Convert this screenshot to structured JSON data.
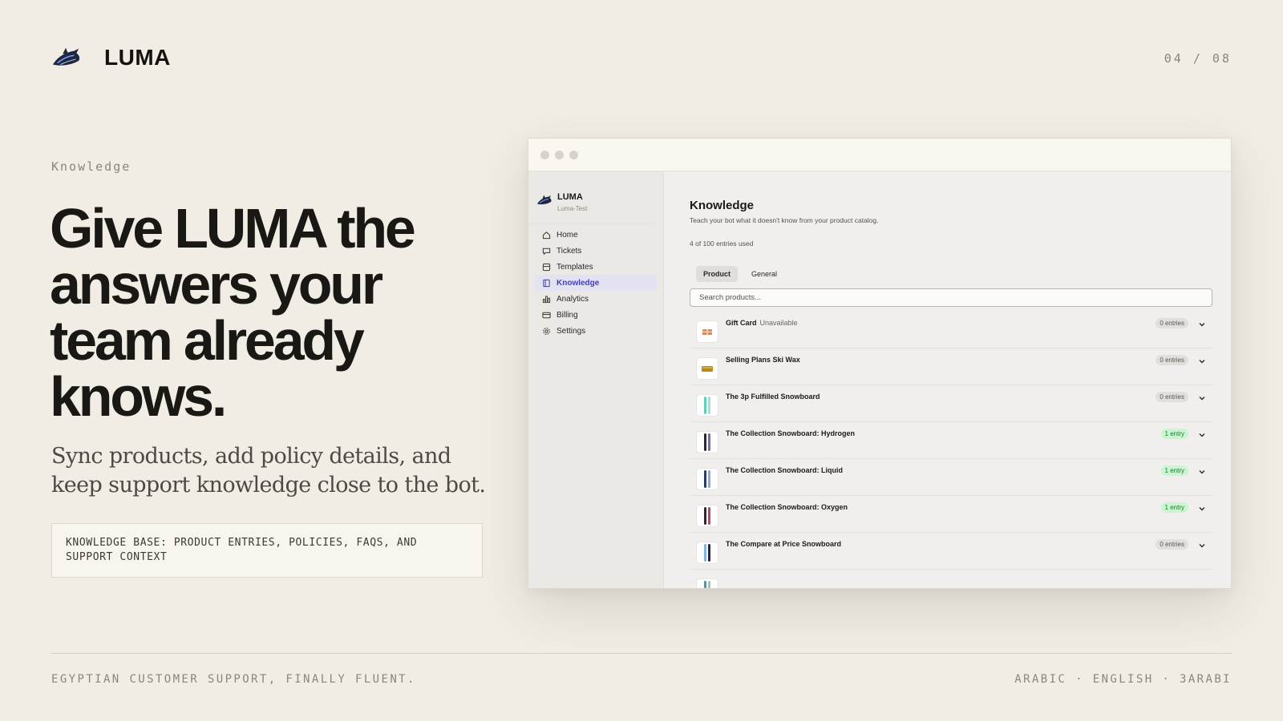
{
  "brand": {
    "name": "LUMA",
    "logo_icon": "shark-logo-icon"
  },
  "slide_counter": "04 / 08",
  "eyebrow": "Knowledge",
  "headline": "Give LUMA the answers your team already knows.",
  "subhead": "Sync products, add policy details, and keep support knowledge close to the bot.",
  "callout": "KNOWLEDGE BASE: PRODUCT ENTRIES, POLICIES, FAQS, AND SUPPORT CONTEXT",
  "footer": {
    "left": "EGYPTIAN CUSTOMER SUPPORT, FINALLY FLUENT.",
    "right": "ARABIC · ENGLISH · 3ARABI"
  },
  "app": {
    "workspace": {
      "name": "LUMA",
      "sub": "Luma-Test"
    },
    "nav": [
      {
        "label": "Home",
        "icon": "home-icon"
      },
      {
        "label": "Tickets",
        "icon": "chat-icon"
      },
      {
        "label": "Templates",
        "icon": "template-icon"
      },
      {
        "label": "Knowledge",
        "icon": "book-icon",
        "active": true
      },
      {
        "label": "Analytics",
        "icon": "bar-chart-icon"
      },
      {
        "label": "Billing",
        "icon": "credit-card-icon"
      },
      {
        "label": "Settings",
        "icon": "gear-icon"
      }
    ],
    "page": {
      "title": "Knowledge",
      "description": "Teach your bot what it doesn't know from your product catalog.",
      "usage": "4 of 100 entries used",
      "tabs": [
        "Product",
        "General"
      ],
      "active_tab": "Product",
      "search_placeholder": "Search products..."
    },
    "products": [
      {
        "name": "Gift Card",
        "status": "Unavailable",
        "entries": "0 entries",
        "has_entries": false
      },
      {
        "name": "Selling Plans Ski Wax",
        "status": "",
        "entries": "0 entries",
        "has_entries": false
      },
      {
        "name": "The 3p Fulfilled Snowboard",
        "status": "",
        "entries": "0 entries",
        "has_entries": false
      },
      {
        "name": "The Collection Snowboard: Hydrogen",
        "status": "",
        "entries": "1 entry",
        "has_entries": true
      },
      {
        "name": "The Collection Snowboard: Liquid",
        "status": "",
        "entries": "1 entry",
        "has_entries": true
      },
      {
        "name": "The Collection Snowboard: Oxygen",
        "status": "",
        "entries": "1 entry",
        "has_entries": true
      },
      {
        "name": "The Compare at Price Snowboard",
        "status": "",
        "entries": "0 entries",
        "has_entries": false
      }
    ],
    "colors": {
      "accent": "#3f3fbf",
      "success_bg": "#c9f5cf",
      "success_text": "#1d7a2b"
    }
  }
}
